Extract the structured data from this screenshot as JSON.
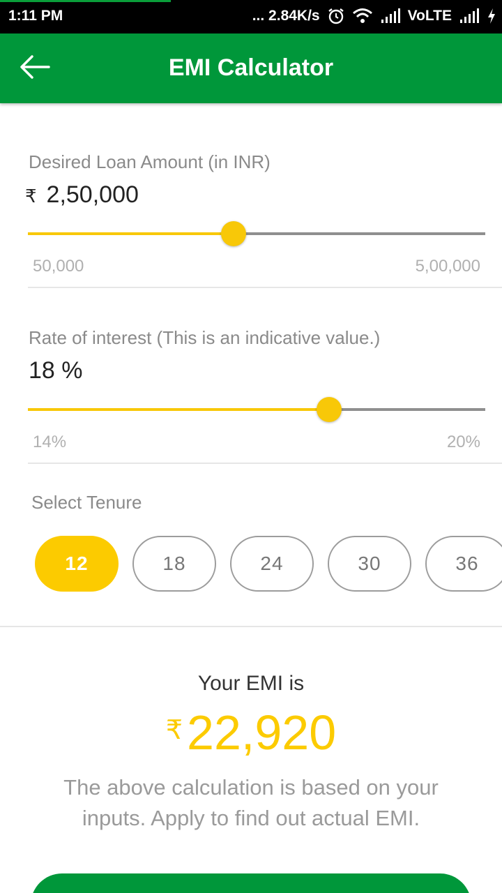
{
  "status_bar": {
    "time": "1:11 PM",
    "network_speed": "... 2.84K/s",
    "network_type": "VoLTE",
    "icons": [
      "alarm-icon",
      "wifi-icon",
      "signal-icon",
      "signal-icon",
      "charging-icon"
    ]
  },
  "app_bar": {
    "title": "EMI Calculator",
    "back_icon": "arrow-left-icon"
  },
  "loan_amount": {
    "label": "Desired Loan Amount (in INR)",
    "currency_symbol": "₹",
    "value": "2,50,000",
    "min_label": "50,000",
    "max_label": "5,00,000",
    "slider_position": 0.45
  },
  "interest": {
    "label": "Rate of interest (This is an indicative value.)",
    "value": "18 %",
    "min_label": "14%",
    "max_label": "20%",
    "slider_position": 0.658
  },
  "tenure": {
    "label": "Select Tenure",
    "options": [
      "12",
      "18",
      "24",
      "30",
      "36"
    ],
    "selected": "12"
  },
  "result": {
    "label": "Your EMI is",
    "currency_symbol": "₹",
    "value": "22,920",
    "note": "The above calculation is based on your inputs. Apply to find out actual EMI."
  },
  "colors": {
    "brand_green": "#00973a",
    "accent_yellow": "#fccb00",
    "slider_yellow": "#f8c808"
  }
}
